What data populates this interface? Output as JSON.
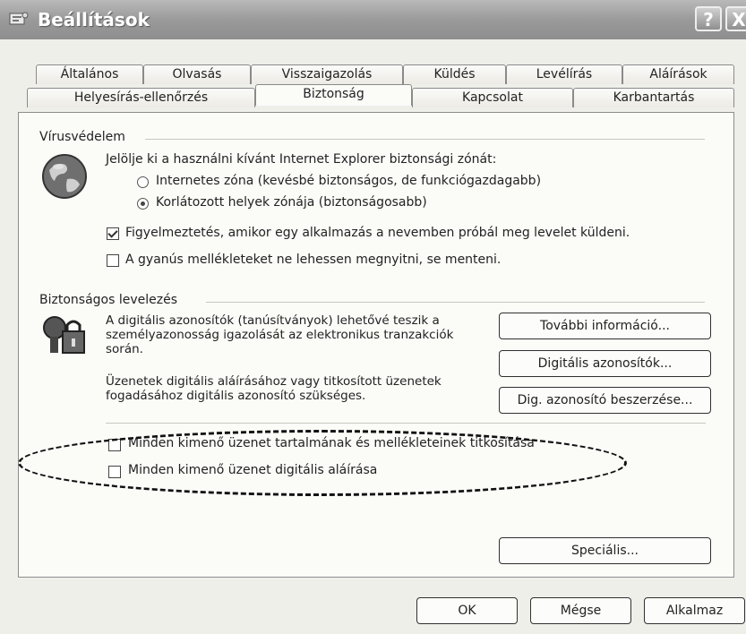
{
  "window": {
    "title": "Beállítások",
    "help_button": "?",
    "close_button": "X"
  },
  "tabs_row1": [
    "Általános",
    "Olvasás",
    "Visszaigazolás",
    "Küldés",
    "Levélírás",
    "Aláírások"
  ],
  "tabs_row2": [
    "Helyesírás-ellenőrzés",
    "Biztonság",
    "Kapcsolat",
    "Karbantartás"
  ],
  "active_tab": "Biztonság",
  "virus": {
    "title": "Vírusvédelem",
    "zone_prompt": "Jelölje ki a használni kívánt Internet Explorer biztonsági zónát:",
    "radio_internet": "Internetes zóna (kevésbé biztonságos, de funkciógazdagabb)",
    "radio_restricted": "Korlátozott helyek zónája (biztonságosabb)",
    "selected_radio": "restricted",
    "warn_check": "Figyelmeztetés, amikor egy alkalmazás a nevemben próbál meg levelet küldeni.",
    "warn_checked": true,
    "attach_check": "A gyanús mellékleteket ne lehessen megnyitni, se menteni.",
    "attach_checked": false
  },
  "secure": {
    "title": "Biztonságos levelezés",
    "desc1": "A digitális azonosítók (tanúsítványok) lehetővé teszik a személyazonosság igazolását az elektronikus tranzakciók során.",
    "desc2": "Üzenetek digitális aláírásához vagy titkosított üzenetek fogadásához digitális azonosító szükséges.",
    "btn_more": "További információ...",
    "btn_ids": "Digitális azonosítók...",
    "btn_get": "Dig. azonosító beszerzése...",
    "encrypt_check": "Minden kimenő üzenet tartalmának és mellékleteinek titkosítása",
    "encrypt_checked": false,
    "sign_check": "Minden kimenő üzenet digitális aláírása",
    "sign_checked": false,
    "btn_advanced": "Speciális..."
  },
  "footer": {
    "ok": "OK",
    "cancel": "Mégse",
    "apply": "Alkalmaz"
  }
}
